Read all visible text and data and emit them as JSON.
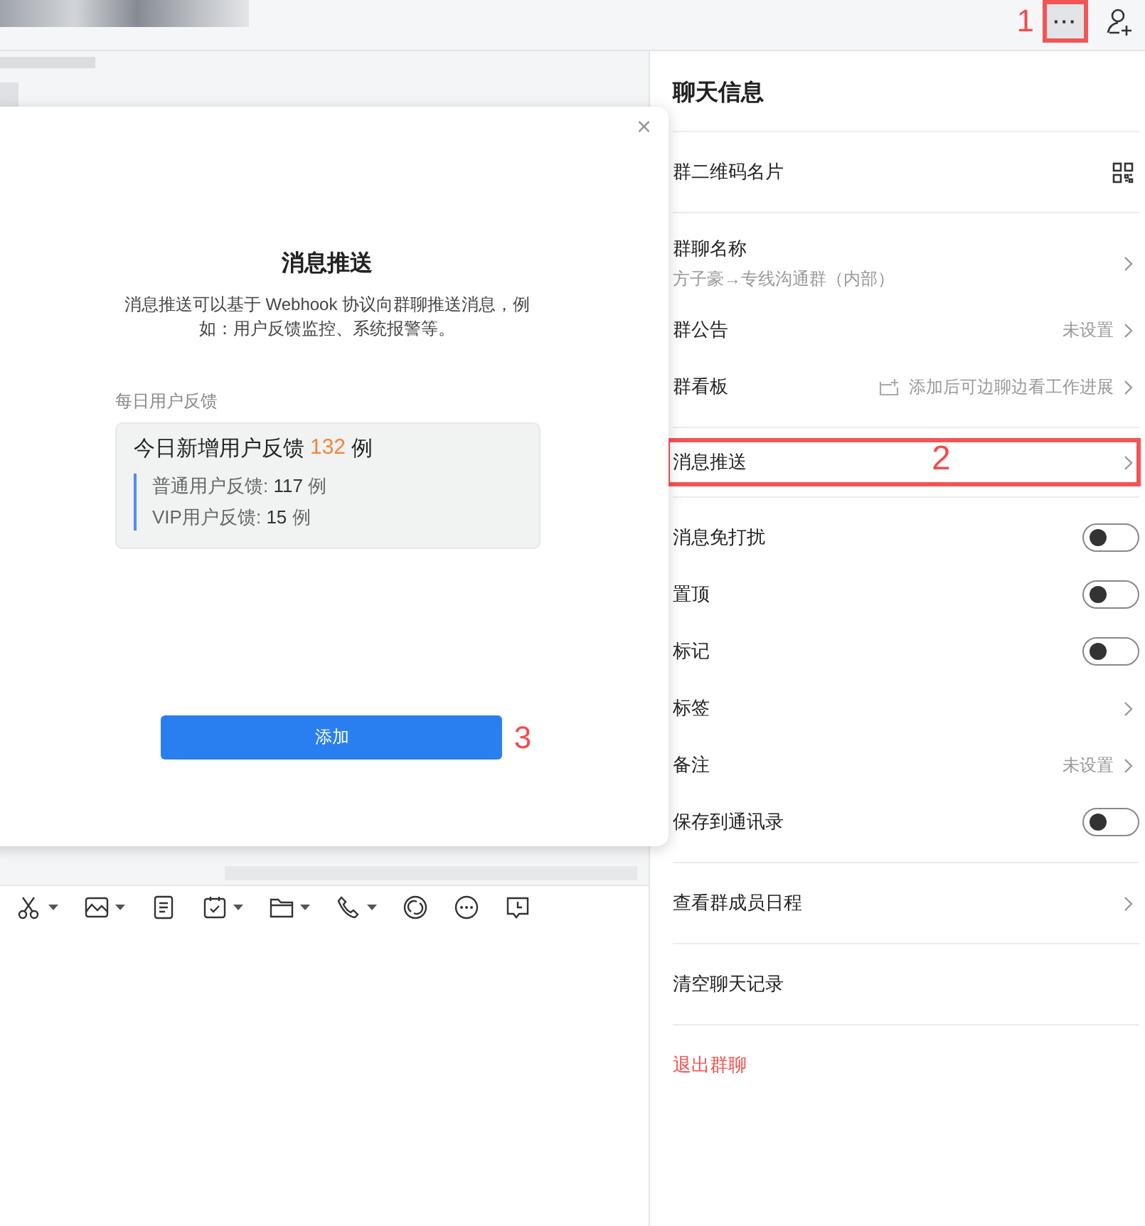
{
  "header": {
    "more_button": {
      "label": "···",
      "annotation": "1"
    }
  },
  "dialog": {
    "close": "×",
    "title": "消息推送",
    "description": "消息推送可以基于 Webhook 协议向群聊推送消息，例如：用户反馈监控、系统报警等。",
    "example_label": "每日用户反馈",
    "card": {
      "title_prefix": "今日新增用户反馈",
      "count": "132",
      "title_suffix": "例",
      "lines": [
        "普通用户反馈: **117** 例",
        "VIP用户反馈: **15** 例"
      ]
    },
    "button": {
      "label": "添加",
      "annotation": "3"
    }
  },
  "panel": {
    "title": "聊天信息",
    "sections": [
      [
        {
          "label": "群二维码名片",
          "kind": "qr"
        }
      ],
      [
        {
          "label": "群聊名称",
          "subtitle": "方子豪→专线沟通群（内部）",
          "kind": "chevron"
        },
        {
          "label": "群公告",
          "value": "未设置",
          "kind": "chevron"
        },
        {
          "label": "群看板",
          "value": "添加后可边聊边看工作进展",
          "kind": "board"
        }
      ],
      [
        {
          "label": "消息推送",
          "kind": "chevron",
          "annotation": "2"
        }
      ],
      [
        {
          "label": "消息免打扰",
          "kind": "toggle",
          "on": false
        },
        {
          "label": "置顶",
          "kind": "toggle",
          "on": false
        },
        {
          "label": "标记",
          "kind": "toggle",
          "on": false
        },
        {
          "label": "标签",
          "kind": "chevron"
        },
        {
          "label": "备注",
          "value": "未设置",
          "kind": "chevron"
        },
        {
          "label": "保存到通讯录",
          "kind": "toggle",
          "on": false
        }
      ],
      [
        {
          "label": "查看群成员日程",
          "kind": "chevron"
        }
      ],
      [
        {
          "label": "清空聊天记录",
          "kind": "action"
        }
      ],
      [
        {
          "label": "退出群聊",
          "kind": "danger"
        }
      ]
    ]
  }
}
